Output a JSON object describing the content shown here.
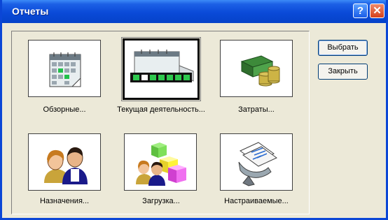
{
  "window": {
    "title": "Отчеты"
  },
  "controls": {
    "help": "?",
    "close": "✕"
  },
  "buttons": {
    "select": "Выбрать",
    "close": "Закрыть"
  },
  "tiles": [
    {
      "label": "Обзорные...",
      "icon": "calendar-overview-icon"
    },
    {
      "label": "Текущая деятельность...",
      "icon": "current-activity-icon"
    },
    {
      "label": "Затраты...",
      "icon": "costs-money-icon"
    },
    {
      "label": "Назначения...",
      "icon": "people-assignments-icon"
    },
    {
      "label": "Загрузка...",
      "icon": "workload-blocks-icon"
    },
    {
      "label": "Настраиваемые...",
      "icon": "custom-reports-icon"
    }
  ],
  "selected_tile": "Текущая деятельность..."
}
